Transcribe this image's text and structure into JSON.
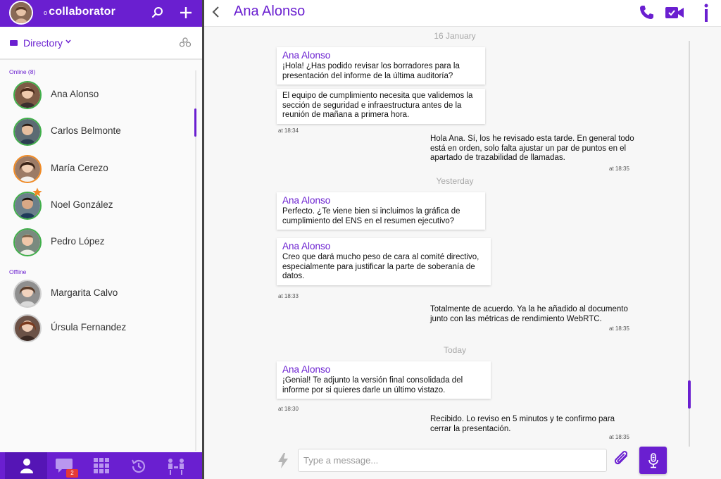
{
  "app": {
    "brand_prefix": "o",
    "brand_name": "collaborator",
    "accent_color": "#6a1fd0"
  },
  "icons": [
    "search-icon",
    "plus-icon",
    "chevron-down-icon",
    "back-arrow-icon",
    "phone-icon",
    "video-icon",
    "info-icon",
    "bolt-icon",
    "paperclip-icon",
    "microphone-icon",
    "user-icon",
    "chat-icon",
    "grid-icon",
    "history-icon",
    "org-chart-icon"
  ],
  "sidebar": {
    "directory_label": "Directory",
    "online_label": "Online (8)",
    "offline_label": "Offline",
    "online_contacts": [
      {
        "name": "Ana Alonso",
        "status_color": "#3fae49"
      },
      {
        "name": "Carlos Belmonte",
        "status_color": "#3fae49"
      },
      {
        "name": "María Cerezo",
        "status_color": "#f08a24"
      },
      {
        "name": "Noel González",
        "status_color": "#3fae49"
      },
      {
        "name": "Pedro López",
        "status_color": "#3fae49"
      }
    ],
    "offline_contacts": [
      {
        "name": "Margarita Calvo"
      },
      {
        "name": "Úrsula Fernandez"
      }
    ]
  },
  "bottom_nav": {
    "chat_badge": "2"
  },
  "chat": {
    "title": "Ana Alonso",
    "sections": [
      {
        "date": "16 January",
        "received": [
          {
            "sender": "Ana Alonso",
            "text": "¡Hola! ¿Has podido revisar los borradores para la presentación del informe de la última auditoría?"
          },
          {
            "text": "El equipo de cumplimiento necesita que validemos la sección de seguridad e infraestructura antes de la reunión de mañana a primera hora."
          }
        ],
        "received_time": "at 18:34",
        "sent_text": "Hola Ana. Sí, los he revisado esta tarde. En general todo está en orden, solo falta ajustar un par de puntos en el apartado de trazabilidad de llamadas.",
        "sent_time": "at 18:35"
      },
      {
        "date": "Yesterday",
        "received": [
          {
            "sender": "Ana Alonso",
            "text": "Perfecto. ¿Te viene bien si incluimos la gráfica de cumplimiento del ENS en el resumen ejecutivo?"
          },
          {
            "sender": "Ana Alonso",
            "text": "Creo que dará mucho peso de cara al comité directivo, especialmente para justificar la parte de soberanía de datos."
          }
        ],
        "received_time": "at 18:33",
        "sent_text": "Totalmente de acuerdo. Ya la he añadido al documento junto con las métricas de rendimiento WebRTC.",
        "sent_time": "at 18:35"
      },
      {
        "date": "Today",
        "received": [
          {
            "sender": "Ana Alonso",
            "text": "¡Genial! Te adjunto la versión final consolidada del informe por si quieres darle un último vistazo."
          }
        ],
        "received_time": "at 18:30",
        "sent_text": "Recibido. Lo reviso en 5 minutos y te confirmo para cerrar la presentación.",
        "sent_time": "at 18:35"
      }
    ],
    "composer": {
      "placeholder": "Type a message..."
    }
  }
}
